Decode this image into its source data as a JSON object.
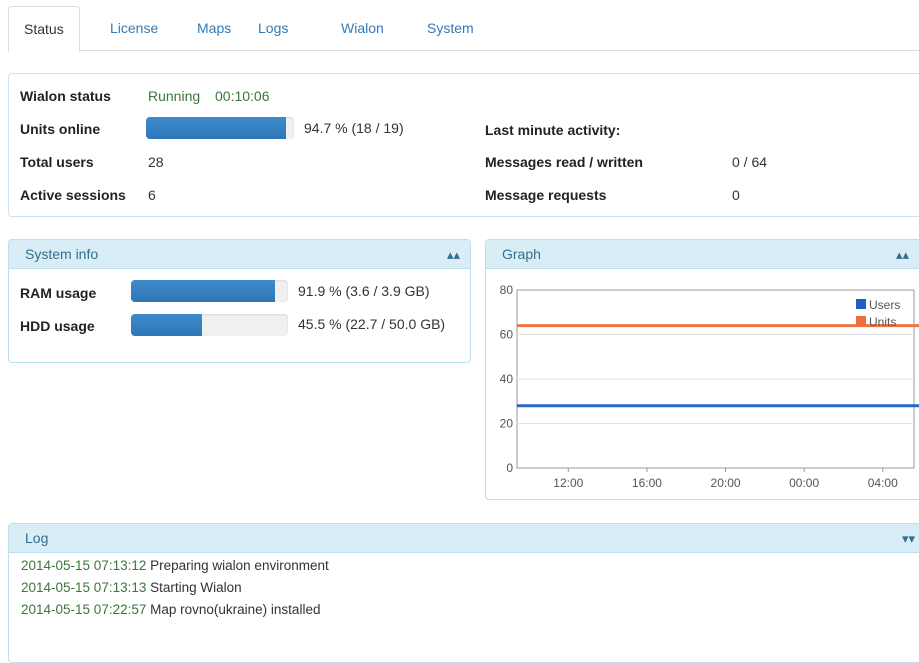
{
  "tabs": [
    {
      "label": "Status",
      "active": true
    },
    {
      "label": "License"
    },
    {
      "label": "Maps"
    },
    {
      "label": "Logs"
    },
    {
      "label": "Wialon"
    },
    {
      "label": "System"
    }
  ],
  "status": {
    "wialon_status_label": "Wialon status",
    "wialon_status_value": "Running",
    "uptime": "00:10:06",
    "units_online_label": "Units online",
    "units_online_text": "94.7 % (18 / 19)",
    "units_online_fraction": 0.947,
    "total_users_label": "Total users",
    "total_users_value": "28",
    "active_sessions_label": "Active sessions",
    "active_sessions_value": "6",
    "last_minute_label": "Last minute activity:",
    "messages_rw_label": "Messages read / written",
    "messages_rw_value": "0 / 64",
    "message_requests_label": "Message requests",
    "message_requests_value": "0"
  },
  "system_info": {
    "title": "System info",
    "ram_label": "RAM usage",
    "ram_text": "91.9 % (3.6 / 3.9 GB)",
    "ram_fraction": 0.919,
    "hdd_label": "HDD usage",
    "hdd_text": "45.5 % (22.7 / 50.0 GB)",
    "hdd_fraction": 0.455,
    "collapse_icon": "chevron-double-up-icon"
  },
  "graph": {
    "title": "Graph",
    "collapse_icon": "chevron-double-up-icon"
  },
  "chart_data": {
    "type": "line",
    "x_ticks": [
      "12:00",
      "16:00",
      "20:00",
      "00:00",
      "04:00"
    ],
    "ylim": [
      0,
      80
    ],
    "y_ticks": [
      0,
      20,
      40,
      60,
      80
    ],
    "legend_position": "top-right",
    "grid": true,
    "series": [
      {
        "name": "Users",
        "color": "#1f5fc4",
        "value": 28
      },
      {
        "name": "Units",
        "color": "#f26d3d",
        "value": 64
      }
    ]
  },
  "log": {
    "title": "Log",
    "expand_icon": "chevron-double-down-icon",
    "entries": [
      {
        "ts": "2014-05-15 07:13:12",
        "msg": "Preparing wialon environment"
      },
      {
        "ts": "2014-05-15 07:13:13",
        "msg": "Starting Wialon"
      },
      {
        "ts": "2014-05-15 07:22:57",
        "msg": "Map rovno(ukraine) installed"
      }
    ]
  },
  "colors": {
    "accent": "#337ab7",
    "panel_header_bg": "#d9edf7",
    "success_text": "#3c763d"
  }
}
